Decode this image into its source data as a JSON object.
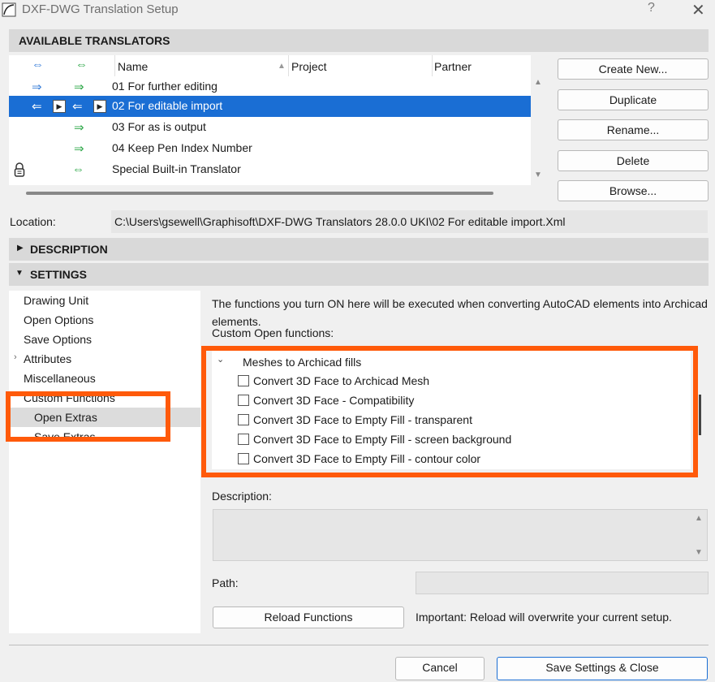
{
  "window": {
    "title": "DXF-DWG Translation Setup",
    "help": "?",
    "close": "✕"
  },
  "translators": {
    "header": "AVAILABLE TRANSLATORS",
    "columns": {
      "name": "Name",
      "project": "Project",
      "partner": "Partner",
      "sort_indicator": "▲"
    },
    "rows": [
      {
        "name": "01 For further editing"
      },
      {
        "name": "02 For editable import"
      },
      {
        "name": "03 For as is output"
      },
      {
        "name": "04 Keep Pen Index Number"
      },
      {
        "name": "Special Built-in Translator"
      }
    ],
    "buttons": {
      "create_new": "Create New...",
      "duplicate": "Duplicate",
      "rename": "Rename...",
      "delete": "Delete",
      "browse": "Browse..."
    }
  },
  "location": {
    "label": "Location:",
    "value": "C:\\Users\\gsewell\\Graphisoft\\DXF-DWG Translators 28.0.0 UKI\\02 For editable import.Xml"
  },
  "sections": {
    "description": "DESCRIPTION",
    "settings": "SETTINGS"
  },
  "nav": {
    "items": [
      "Drawing Unit",
      "Open Options",
      "Save Options",
      "Attributes",
      "Miscellaneous",
      "Custom Functions",
      "Open Extras",
      "Save Extras"
    ],
    "partial_item": "Save Extras"
  },
  "content": {
    "intro": "The functions you turn ON here will be executed when converting AutoCAD elements into Archicad elements.",
    "custom_label": "Custom Open functions:",
    "group_label": "Meshes to Archicad fills",
    "functions": [
      "Convert 3D Face to Archicad Mesh",
      "Convert 3D Face - Compatibility",
      "Convert 3D Face to Empty Fill - transparent",
      "Convert 3D Face to Empty Fill - screen background",
      "Convert 3D Face to Empty Fill - contour color"
    ],
    "description_label": "Description:",
    "path_label": "Path:",
    "reload_button": "Reload Functions",
    "important_note": "Important: Reload will overwrite your current setup."
  },
  "footer": {
    "cancel": "Cancel",
    "save_close": "Save Settings & Close"
  },
  "colors": {
    "selection": "#1a6ed4",
    "highlight_box": "#ff5a0a",
    "blue_arrow": "#3a7fd9",
    "green_arrow": "#2fa84a"
  }
}
